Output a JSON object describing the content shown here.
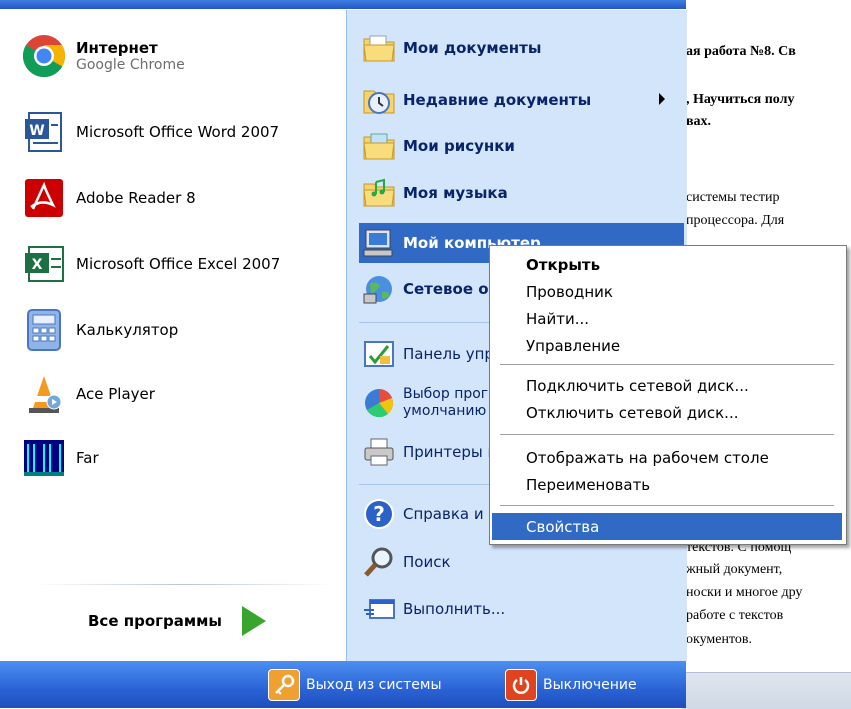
{
  "document": {
    "lines": [
      {
        "text": "ая работа №8. Св",
        "bold": true
      },
      {
        "text": ", Научиться полу",
        "bold": true
      },
      {
        "text": "вах.",
        "bold": true
      },
      {
        "text": " системы тестир",
        "bold": false
      },
      {
        "text": " процессора. Для ",
        "bold": false
      },
      {
        "text": "текстов. С помощ",
        "bold": false
      },
      {
        "text": "жный документ,",
        "bold": false
      },
      {
        "text": "носки и многое дру",
        "bold": false
      },
      {
        "text": "работе с текстов",
        "bold": false
      },
      {
        "text": "окументов.",
        "bold": false
      }
    ]
  },
  "left": {
    "pinned": {
      "title": "Интернет",
      "subtitle": "Google Chrome"
    },
    "items": [
      {
        "label": "Microsoft Office Word 2007"
      },
      {
        "label": "Adobe Reader 8"
      },
      {
        "label": "Microsoft Office Excel 2007"
      },
      {
        "label": "Калькулятор"
      },
      {
        "label": "Ace Player"
      },
      {
        "label": "Far"
      }
    ],
    "all_programs": "Все программы"
  },
  "right": {
    "my_documents": "Мои документы",
    "recent": "Недавние документы",
    "my_pictures": "Мои рисунки",
    "my_music": "Моя музыка",
    "my_computer": "Мой компьютер",
    "network": "Сетевое окружение",
    "control_panel": "Панель управления",
    "default_programs_1": "Выбор программ по",
    "default_programs_2": "умолчанию",
    "printers": "Принтеры и факсы",
    "help": "Справка и поддержка",
    "search": "Поиск",
    "run": "Выполнить..."
  },
  "bottom": {
    "logoff": "Выход из системы",
    "shutdown": "Выключение"
  },
  "context_menu": {
    "open": "Открыть",
    "explorer": "Проводник",
    "find": "Найти...",
    "manage": "Управление",
    "map_drive": "Подключить сетевой диск...",
    "disconnect_drive": "Отключить сетевой диск...",
    "show_on_desktop": "Отображать на рабочем столе",
    "rename": "Переименовать",
    "properties": "Свойства"
  },
  "colors": {
    "highlight": "#316ac5",
    "right_pane": "#d3e5fa",
    "bar": "#2a63d6"
  }
}
